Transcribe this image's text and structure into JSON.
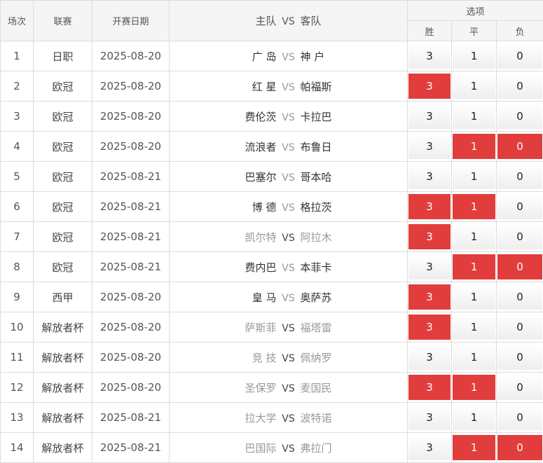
{
  "header": {
    "index": "场次",
    "league": "联赛",
    "date": "开赛日期",
    "home": "主队",
    "vs": "VS",
    "away": "客队",
    "options": "选项",
    "win": "胜",
    "draw": "平",
    "lose": "负"
  },
  "colors": {
    "selected": "#e23d3d",
    "border": "#dcdcdc",
    "header_bg": "#f5f5f5"
  },
  "rows": [
    {
      "index": "1",
      "league": "日职",
      "date": "2025-08-20",
      "home": "广 岛",
      "vs": "VS",
      "away": "神 户",
      "dim": false,
      "win": "3",
      "draw": "1",
      "lose": "0",
      "sel": []
    },
    {
      "index": "2",
      "league": "欧冠",
      "date": "2025-08-20",
      "home": "红 星",
      "vs": "VS",
      "away": "帕福斯",
      "dim": false,
      "win": "3",
      "draw": "1",
      "lose": "0",
      "sel": [
        "win"
      ]
    },
    {
      "index": "3",
      "league": "欧冠",
      "date": "2025-08-20",
      "home": "费伦茨",
      "vs": "VS",
      "away": "卡拉巴",
      "dim": false,
      "win": "3",
      "draw": "1",
      "lose": "0",
      "sel": []
    },
    {
      "index": "4",
      "league": "欧冠",
      "date": "2025-08-20",
      "home": "流浪者",
      "vs": "VS",
      "away": "布鲁日",
      "dim": false,
      "win": "3",
      "draw": "1",
      "lose": "0",
      "sel": [
        "draw",
        "lose"
      ]
    },
    {
      "index": "5",
      "league": "欧冠",
      "date": "2025-08-21",
      "home": "巴塞尔",
      "vs": "VS",
      "away": "哥本哈",
      "dim": false,
      "win": "3",
      "draw": "1",
      "lose": "0",
      "sel": []
    },
    {
      "index": "6",
      "league": "欧冠",
      "date": "2025-08-21",
      "home": "博 德",
      "vs": "VS",
      "away": "格拉茨",
      "dim": false,
      "win": "3",
      "draw": "1",
      "lose": "0",
      "sel": [
        "win",
        "draw"
      ]
    },
    {
      "index": "7",
      "league": "欧冠",
      "date": "2025-08-21",
      "home": "凯尔特",
      "vs": "VS",
      "away": "阿拉木",
      "dim": true,
      "win": "3",
      "draw": "1",
      "lose": "0",
      "sel": [
        "win"
      ]
    },
    {
      "index": "8",
      "league": "欧冠",
      "date": "2025-08-21",
      "home": "费内巴",
      "vs": "VS",
      "away": "本菲卡",
      "dim": false,
      "win": "3",
      "draw": "1",
      "lose": "0",
      "sel": [
        "draw",
        "lose"
      ]
    },
    {
      "index": "9",
      "league": "西甲",
      "date": "2025-08-20",
      "home": "皇 马",
      "vs": "VS",
      "away": "奥萨苏",
      "dim": false,
      "win": "3",
      "draw": "1",
      "lose": "0",
      "sel": [
        "win"
      ]
    },
    {
      "index": "10",
      "league": "解放者杯",
      "date": "2025-08-20",
      "home": "萨斯菲",
      "vs": "VS",
      "away": "福塔雷",
      "dim": true,
      "win": "3",
      "draw": "1",
      "lose": "0",
      "sel": [
        "win"
      ]
    },
    {
      "index": "11",
      "league": "解放者杯",
      "date": "2025-08-20",
      "home": "竞 技",
      "vs": "VS",
      "away": "佩纳罗",
      "dim": true,
      "win": "3",
      "draw": "1",
      "lose": "0",
      "sel": []
    },
    {
      "index": "12",
      "league": "解放者杯",
      "date": "2025-08-20",
      "home": "圣保罗",
      "vs": "VS",
      "away": "麦国民",
      "dim": true,
      "win": "3",
      "draw": "1",
      "lose": "0",
      "sel": [
        "win",
        "draw"
      ]
    },
    {
      "index": "13",
      "league": "解放者杯",
      "date": "2025-08-21",
      "home": "拉大学",
      "vs": "VS",
      "away": "波特诺",
      "dim": true,
      "win": "3",
      "draw": "1",
      "lose": "0",
      "sel": []
    },
    {
      "index": "14",
      "league": "解放者杯",
      "date": "2025-08-21",
      "home": "巴国际",
      "vs": "VS",
      "away": "弗拉门",
      "dim": true,
      "win": "3",
      "draw": "1",
      "lose": "0",
      "sel": [
        "draw",
        "lose"
      ]
    }
  ]
}
